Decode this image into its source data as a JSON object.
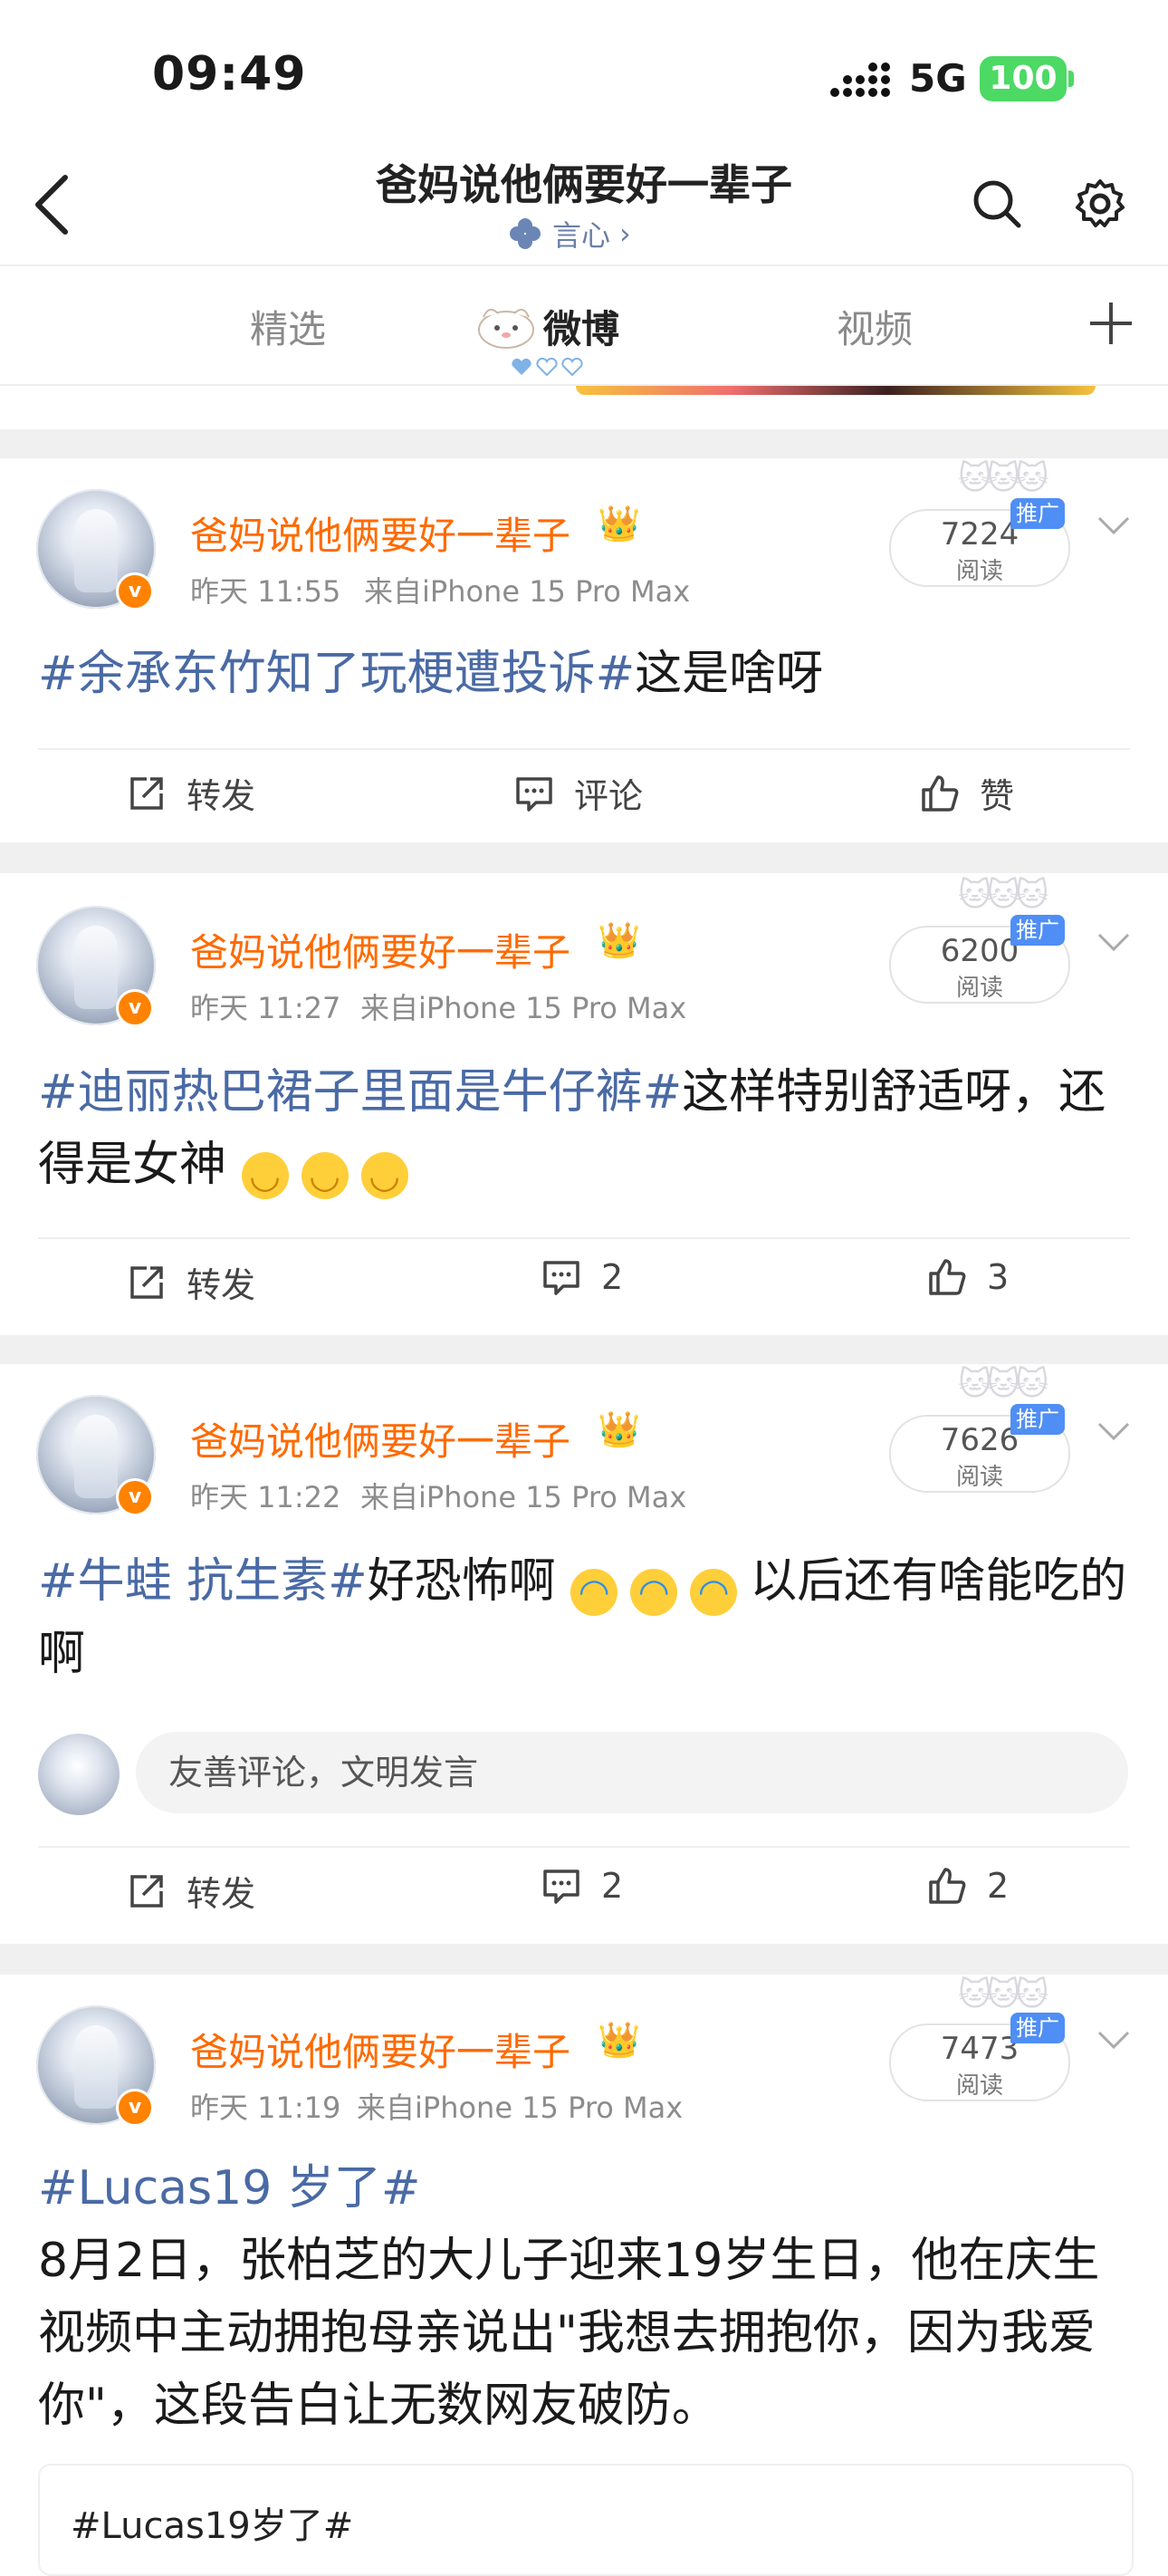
{
  "status_bar": {
    "time": "09:49",
    "network": "5G",
    "battery": "100"
  },
  "header": {
    "title": "爸妈说他俩要好一辈子",
    "subtitle": "言心",
    "subtitle_arrow": "›"
  },
  "tabs": [
    {
      "label": "精选"
    },
    {
      "label": "微博"
    },
    {
      "label": "视频"
    }
  ],
  "posts": [
    {
      "username": "爸妈说他俩要好一辈子",
      "time": "昨天 11:55",
      "source": "来自iPhone 15 Pro Max",
      "read_count": "7224",
      "read_label": "阅读",
      "promo_label": "推广",
      "hashtag": "#余承东竹知了玩梗遭投诉#",
      "text": "这是啥呀",
      "repost_label": "转发",
      "comment_label": "评论",
      "like_label": "赞"
    },
    {
      "username": "爸妈说他俩要好一辈子",
      "time": "昨天 11:27",
      "source": "来自iPhone 15 Pro Max",
      "read_count": "6200",
      "read_label": "阅读",
      "promo_label": "推广",
      "hashtag": "#迪丽热巴裙子里面是牛仔裤#",
      "text": "这样特别舒适呀，还得是女神",
      "repost_label": "转发",
      "comment_label": "2",
      "like_label": "3"
    },
    {
      "username": "爸妈说他俩要好一辈子",
      "time": "昨天 11:22",
      "source": "来自iPhone 15 Pro Max",
      "read_count": "7626",
      "read_label": "阅读",
      "promo_label": "推广",
      "hashtag": "#牛蛙 抗生素#",
      "text": "好恐怖啊",
      "text_after": "以后还有啥能吃的啊",
      "comment_placeholder": "友善评论，文明发言",
      "repost_label": "转发",
      "comment_label": "2",
      "like_label": "2"
    },
    {
      "username": "爸妈说他俩要好一辈子",
      "time": "昨天 11:19",
      "source": "来自iPhone 15 Pro Max",
      "read_count": "7473",
      "read_label": "阅读",
      "promo_label": "推广",
      "hashtag": "#Lucas19 岁了#",
      "text": "8月2日，张柏芝的大儿子迎来19岁生日，他在庆生视频中主动拥抱母亲说出\"我想去拥抱你，因为我爱你\"，这段告白让无数网友破防。",
      "quote_title": "#Lucas19岁了#"
    }
  ],
  "colors": {
    "username": "#ff6a00",
    "hashtag": "#4a6aa5",
    "promo": "#4f8ef5",
    "verified": "#ff8200",
    "battery": "#4cd964"
  }
}
